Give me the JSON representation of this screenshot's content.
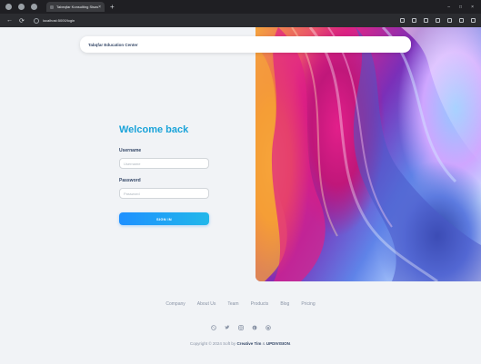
{
  "browser": {
    "tab_title": "Tabeqfar Konsulting Siswa",
    "tab_close": "×",
    "new_tab": "+",
    "url": "localhost:5000/login",
    "back": "←",
    "reload": "⟳",
    "minimize": "–",
    "restore": "□",
    "close": "×"
  },
  "navbar": {
    "brand": "Tabqfar Education Center"
  },
  "login": {
    "title": "Welcome back",
    "username_label": "Username",
    "username_placeholder": "Username",
    "password_label": "Password",
    "password_placeholder": "Password",
    "signin_label": "SIGN IN"
  },
  "footer": {
    "links": [
      "Company",
      "About Us",
      "Team",
      "Products",
      "Blog",
      "Pricing"
    ],
    "social_icons": [
      "dribbble-icon",
      "twitter-icon",
      "instagram-icon",
      "pinterest-icon",
      "github-icon"
    ],
    "copyright_prefix": "Copyright © 2024 Soft by ",
    "copyright_brand": "Creative Tim",
    "copyright_mid": " & ",
    "copyright_brand2": "UPDIVISION",
    "copyright_suffix": "."
  },
  "colors": {
    "accent": "#1aa3d9",
    "heading": "#344767",
    "muted": "#8a94a6"
  }
}
